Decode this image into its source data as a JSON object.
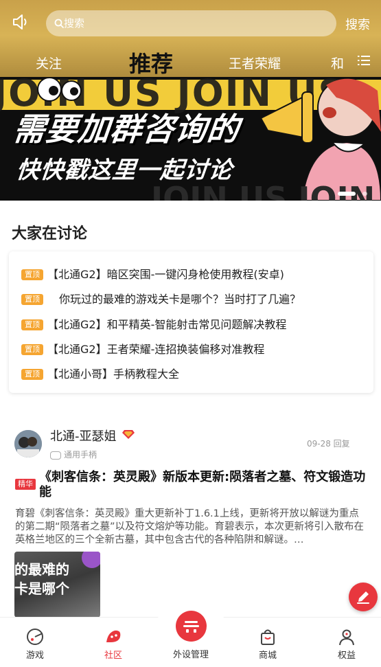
{
  "header": {
    "search_placeholder": "搜索",
    "search_button": "搜索",
    "tabs": [
      "关注",
      "推荐",
      "王者荣耀",
      "和"
    ],
    "active_tab": "推荐"
  },
  "banner": {
    "bg_text": "JOIN US JOIN US",
    "line1": "需要加群咨询的",
    "line2": "快快戳这里一起讨论",
    "slide_count": 2,
    "active_slide": 1
  },
  "discussion": {
    "title": "大家在讨论",
    "badge": "置顶",
    "items": [
      "【北通G2】暗区突围-一键闪身枪使用教程(安卓)",
      "你玩过的最难的游戏关卡是哪个？当时打了几遍？",
      "【北通G2】和平精英-智能射击常见问题解决教程",
      "【北通G2】王者荣耀-连招换装偏移对准教程",
      "【北通小哥】手柄教程大全"
    ]
  },
  "post": {
    "author": "北通-亚瑟姐",
    "sub_tag": "通用手柄",
    "date": "09-28 回复",
    "badge": "精华",
    "title": "《刺客信条：英灵殿》新版本更新:陨落者之墓、符文锻造功能",
    "body": "育碧《刺客信条：英灵殿》重大更新补丁1.6.1上线，更新将开放以解谜为重点的第二期“陨落者之墓”以及符文熔炉等功能。育碧表示，本次更新将引入散布在英格兰地区的三个全新古墓，其中包含古代的各种陷阱和解谜。…",
    "thumb_line1": "的最难的",
    "thumb_line2": "卡是哪个"
  },
  "bottom_nav": {
    "items": [
      "游戏",
      "社区",
      "外设管理",
      "商城",
      "权益"
    ],
    "active": "社区"
  },
  "colors": {
    "accent": "#e8373e",
    "pin_badge": "#f5a531",
    "header_gold": "#d8b356"
  }
}
